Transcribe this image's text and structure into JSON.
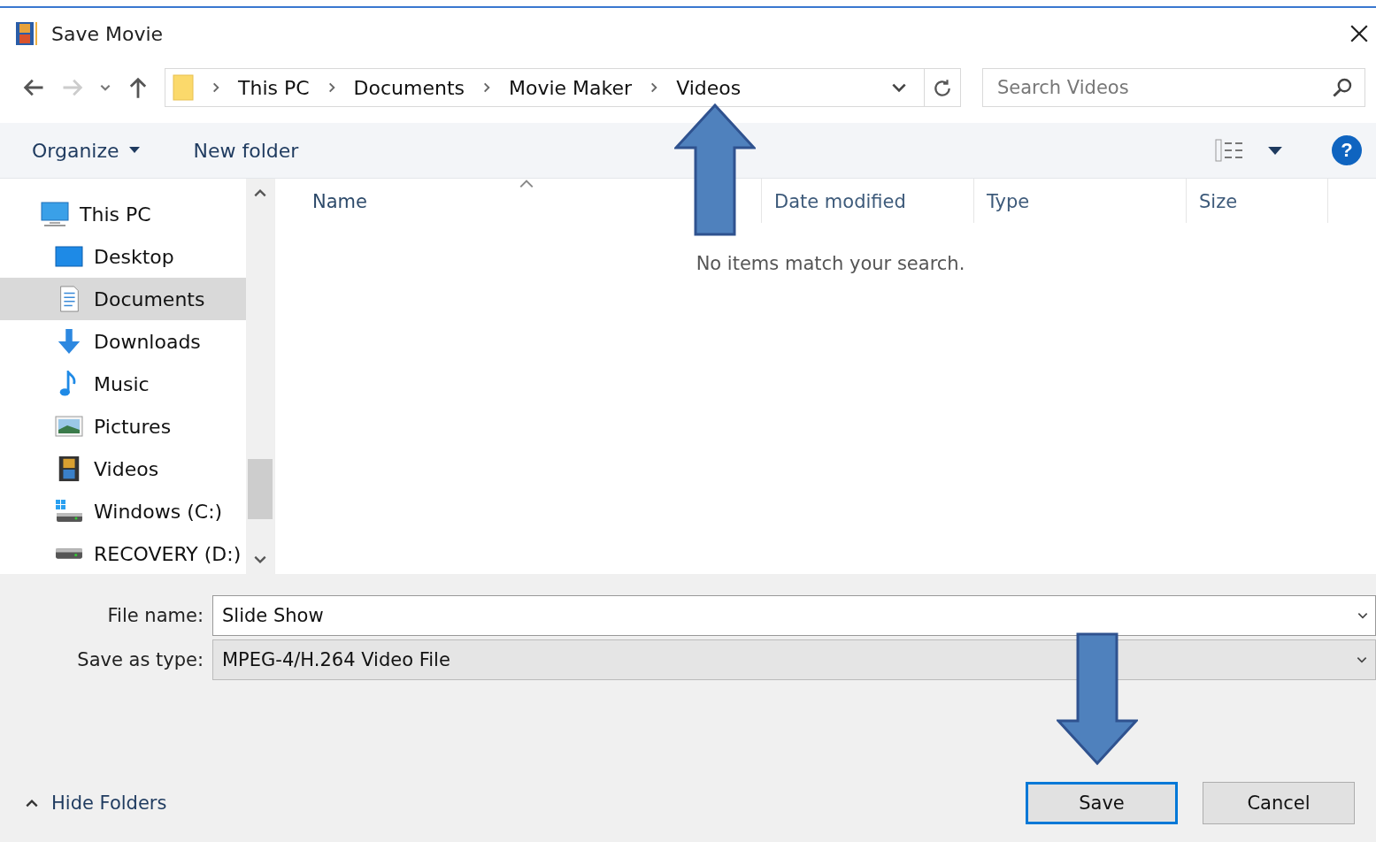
{
  "window": {
    "title": "Save Movie"
  },
  "address": {
    "segments": [
      "This PC",
      "Documents",
      "Movie Maker",
      "Videos"
    ]
  },
  "search": {
    "placeholder": "Search Videos"
  },
  "toolbar": {
    "organize": "Organize",
    "new_folder": "New folder",
    "help": "?"
  },
  "navigation": [
    {
      "label": "This PC",
      "kind": "pc",
      "selected": false,
      "children": [
        {
          "label": "Desktop",
          "kind": "desktop",
          "selected": false
        },
        {
          "label": "Documents",
          "kind": "documents",
          "selected": true
        },
        {
          "label": "Downloads",
          "kind": "downloads",
          "selected": false
        },
        {
          "label": "Music",
          "kind": "music",
          "selected": false
        },
        {
          "label": "Pictures",
          "kind": "pictures",
          "selected": false
        },
        {
          "label": "Videos",
          "kind": "videos",
          "selected": false
        },
        {
          "label": "Windows (C:)",
          "kind": "system-drive",
          "selected": false
        },
        {
          "label": "RECOVERY (D:)",
          "kind": "drive",
          "selected": false
        }
      ]
    }
  ],
  "table": {
    "columns": [
      {
        "label": "Name",
        "sorted": true
      },
      {
        "label": "Date modified",
        "sorted": false
      },
      {
        "label": "Type",
        "sorted": false
      },
      {
        "label": "Size",
        "sorted": false
      }
    ],
    "empty_message": "No items match your search."
  },
  "form": {
    "file_name_label": "File name:",
    "file_name": "Slide Show",
    "type_label": "Save as type:",
    "type": "MPEG-4/H.264 Video File"
  },
  "hide_folders": "Hide Folders",
  "buttons": [
    {
      "label": "Save",
      "default": true
    },
    {
      "label": "Cancel",
      "default": false
    }
  ]
}
